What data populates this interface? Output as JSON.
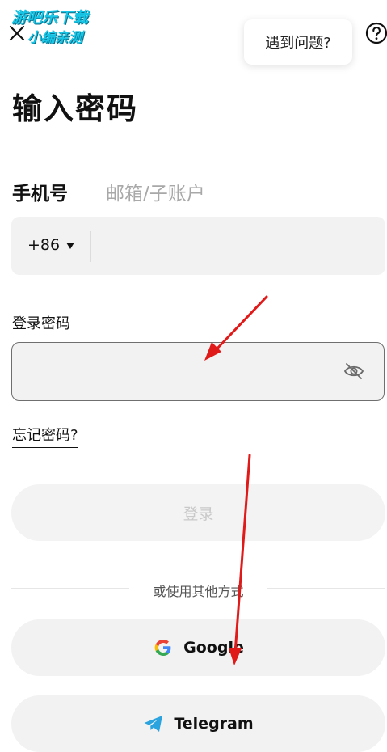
{
  "watermark": {
    "line1": "游吧乐下载",
    "line2": "小编亲测"
  },
  "header": {
    "help_text": "遇到问题?"
  },
  "page_title": "输入密码",
  "tabs": {
    "phone": "手机号",
    "email": "邮箱/子账户"
  },
  "phone": {
    "country_code": "+86",
    "number": ""
  },
  "password": {
    "label": "登录密码",
    "value": ""
  },
  "forgot_password": "忘记密码?",
  "login_button": "登录",
  "divider_text": "或使用其他方式",
  "social": {
    "google": "Google",
    "telegram": "Telegram"
  },
  "colors": {
    "annotation_arrow": "#e01919",
    "field_background": "#f2f2f2",
    "muted_text": "#a8a8a8",
    "telegram_blue": "#2aa3df"
  }
}
